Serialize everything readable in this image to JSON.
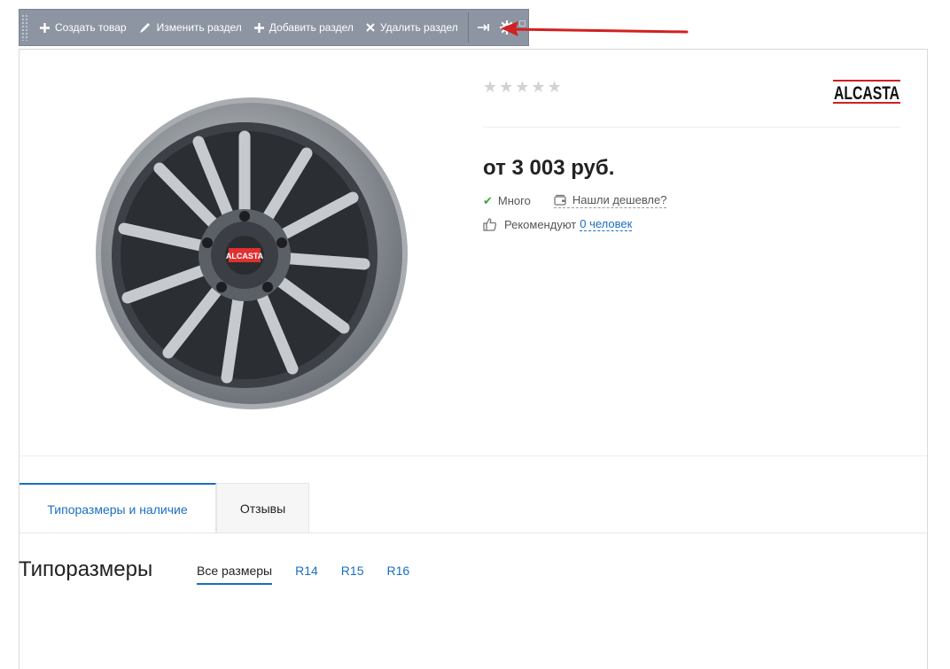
{
  "toolbar": {
    "create_product": "Создать товар",
    "edit_section": "Изменить раздел",
    "add_section": "Добавить раздел",
    "delete_section": "Удалить раздел"
  },
  "product": {
    "rating_stars": 0,
    "brand": "ALCASTA",
    "price": "от 3 003 руб.",
    "stock": "Много",
    "cheaper_link": "Нашли дешевле?",
    "recommend_label": "Рекомендуют",
    "recommend_link": "0 человек"
  },
  "tabs": {
    "sizes_availability": "Типоразмеры и наличие",
    "reviews": "Отзывы"
  },
  "sizes": {
    "title": "Типоразмеры",
    "filters": [
      "Все размеры",
      "R14",
      "R15",
      "R16"
    ]
  },
  "colors": {
    "accent": "#1a6fc0",
    "toolbar_bg": "#8d95a3",
    "arrow": "#d32020",
    "stock_check": "#3ea53e"
  }
}
